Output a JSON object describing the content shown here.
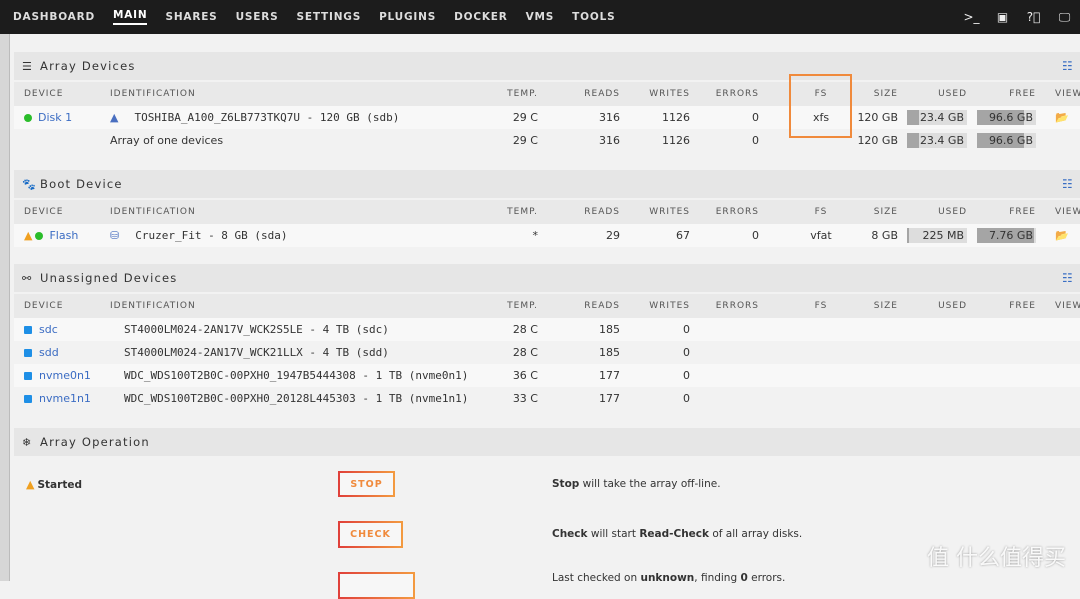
{
  "nav": {
    "items": [
      "DASHBOARD",
      "MAIN",
      "SHARES",
      "USERS",
      "SETTINGS",
      "PLUGINS",
      "DOCKER",
      "VMS",
      "TOOLS"
    ],
    "active": "MAIN",
    "icons": [
      "terminal-icon",
      "feedback-icon",
      "help-icon",
      "monitor-icon"
    ]
  },
  "columns": {
    "device": "DEVICE",
    "identification": "IDENTIFICATION",
    "temp": "TEMP.",
    "reads": "READS",
    "writes": "WRITES",
    "errors": "ERRORS",
    "fs": "FS",
    "size": "SIZE",
    "used": "USED",
    "free": "FREE",
    "view": "VIEW"
  },
  "array": {
    "title": "Array Devices",
    "rows": [
      {
        "device": "Disk 1",
        "id": "TOSHIBA_A100_Z6LB773TKQ7U - 120 GB (sdb)",
        "temp": "29 C",
        "reads": "316",
        "writes": "1126",
        "errors": "0",
        "fs": "xfs",
        "size": "120 GB",
        "used": "23.4 GB",
        "used_pct": 19.5,
        "free": "96.6 GB",
        "free_pct": 80.5
      }
    ],
    "total": {
      "id": "Array of one devices",
      "temp": "29 C",
      "reads": "316",
      "writes": "1126",
      "errors": "0",
      "size": "120 GB",
      "used": "23.4 GB",
      "used_pct": 19.5,
      "free": "96.6 GB",
      "free_pct": 80.5
    }
  },
  "boot": {
    "title": "Boot Device",
    "rows": [
      {
        "device": "Flash",
        "id": "Cruzer_Fit - 8 GB (sda)",
        "temp": "*",
        "reads": "29",
        "writes": "67",
        "errors": "0",
        "fs": "vfat",
        "size": "8 GB",
        "used": "225 MB",
        "used_pct": 2.8,
        "free": "7.76 GB",
        "free_pct": 97
      }
    ]
  },
  "unassigned": {
    "title": "Unassigned Devices",
    "rows": [
      {
        "device": "sdc",
        "id": "ST4000LM024-2AN17V_WCK2S5LE - 4 TB (sdc)",
        "temp": "28 C",
        "reads": "185",
        "writes": "0"
      },
      {
        "device": "sdd",
        "id": "ST4000LM024-2AN17V_WCK21LLX - 4 TB (sdd)",
        "temp": "28 C",
        "reads": "185",
        "writes": "0"
      },
      {
        "device": "nvme0n1",
        "id": "WDC_WDS100T2B0C-00PXH0_1947B5444308 - 1 TB (nvme0n1)",
        "temp": "36 C",
        "reads": "177",
        "writes": "0"
      },
      {
        "device": "nvme1n1",
        "id": "WDC_WDS100T2B0C-00PXH0_20128L445303 - 1 TB (nvme1n1)",
        "temp": "33 C",
        "reads": "177",
        "writes": "0"
      }
    ]
  },
  "operation": {
    "title": "Array Operation",
    "status": "Started",
    "stop": "STOP",
    "check": "CHECK",
    "stop_desc": {
      "b": "Stop",
      "t": " will take the array off-line."
    },
    "check_desc": {
      "b1": "Check",
      "t1": " will start ",
      "b2": "Read-Check",
      "t2": " of all array disks."
    },
    "last": {
      "t1": "Last checked on ",
      "b1": "unknown",
      "t2": ", finding ",
      "b2": "0",
      "t3": " errors."
    }
  },
  "watermark": "值 什么值得买",
  "colors": {
    "accent": "#f08a3c",
    "link": "#3b6cc3",
    "ok": "#2bbd2b",
    "unassigned": "#1e8fe6"
  }
}
